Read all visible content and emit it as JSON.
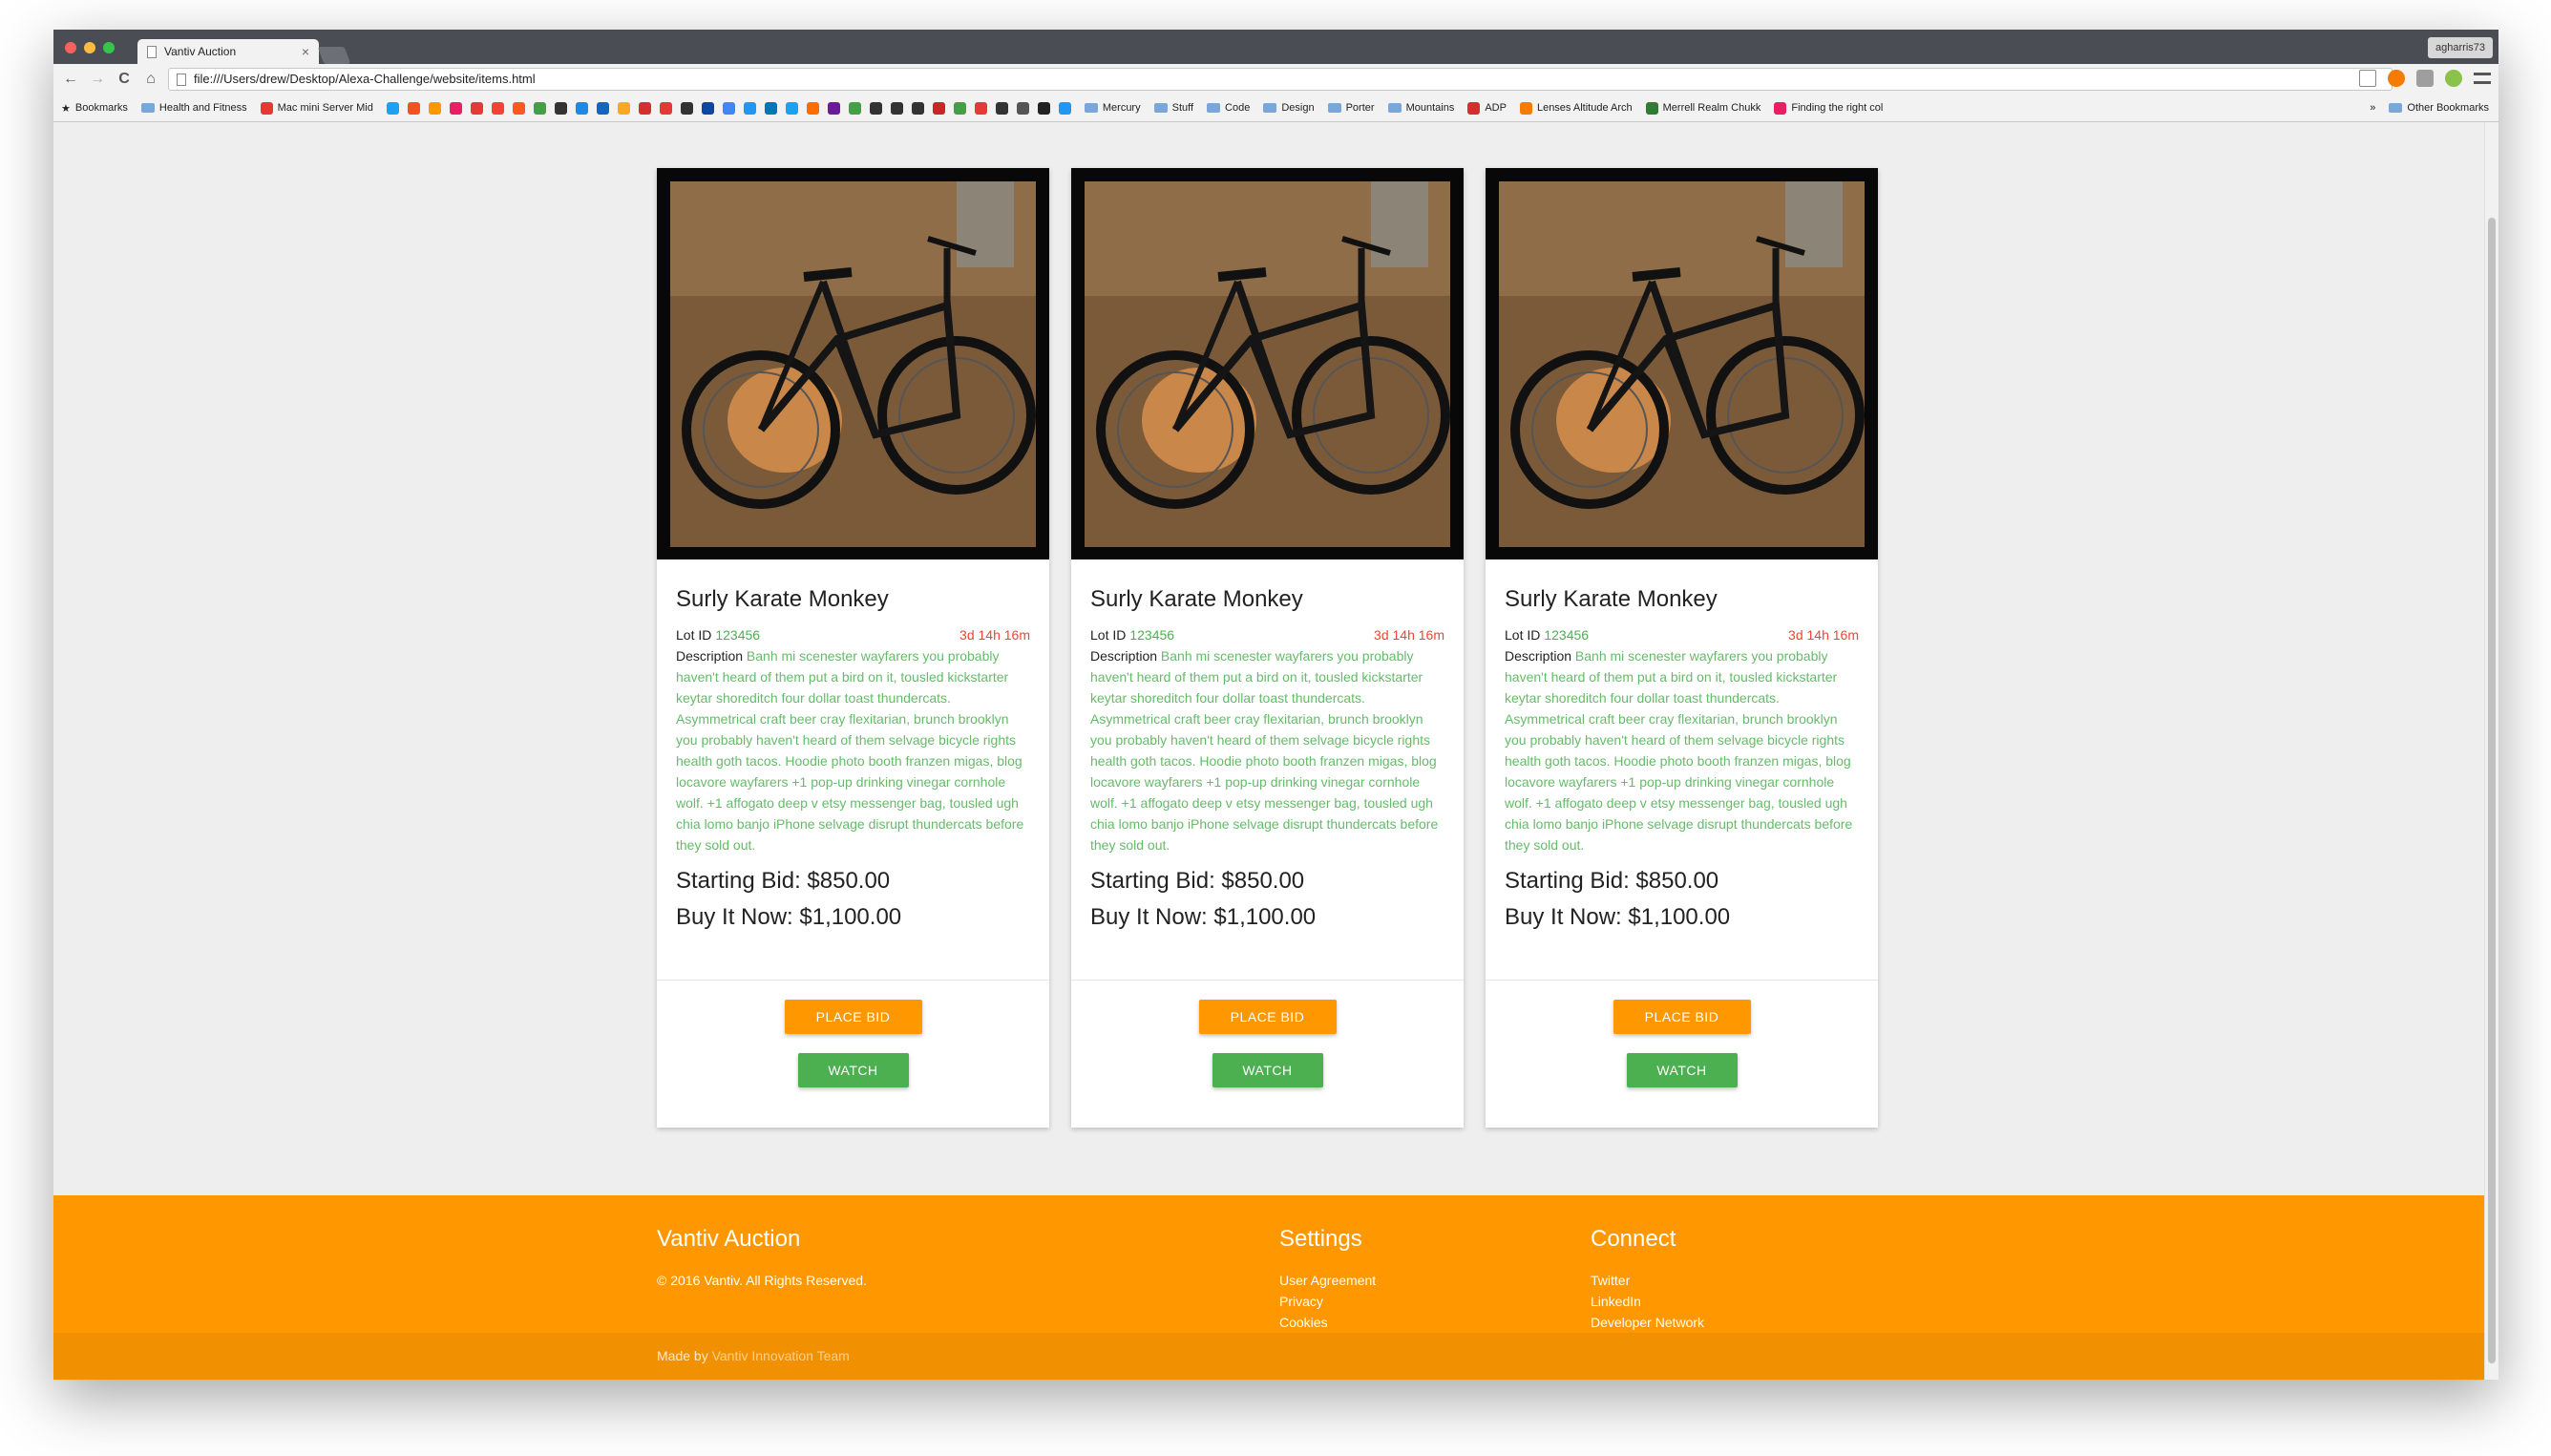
{
  "browser": {
    "tab_title": "Vantiv Auction",
    "tab_close": "×",
    "user": "agharris73",
    "url": "file:///Users/drew/Desktop/Alexa-Challenge/website/items.html",
    "nav": {
      "back": "←",
      "forward": "→",
      "reload": "C",
      "home": "⌂"
    },
    "bookmarks": {
      "bookmarks_label": "Bookmarks",
      "health": "Health and Fitness",
      "macmini": "Mac mini Server Mid",
      "mercury": "Mercury",
      "stuff": "Stuff",
      "code": "Code",
      "design": "Design",
      "porter": "Porter",
      "mountains": "Mountains",
      "adp": "ADP",
      "lenses": "Lenses Altitude Arch",
      "merrell": "Merrell Realm Chukk",
      "finding": "Finding the right col",
      "more": "»",
      "other": "Other Bookmarks"
    },
    "favicon_colors": [
      "#1da1f2",
      "#f4511e",
      "#ff9800",
      "#e91e63",
      "#e53935",
      "#f44336",
      "#ff5722",
      "#43a047",
      "#333333",
      "#1e88e5",
      "#1565c0",
      "#f9a825",
      "#d32f2f",
      "#e53935",
      "#333333",
      "#0d47a1",
      "#4285f4",
      "#2196f3",
      "#0077b5",
      "#1da1f2",
      "#ff6d00",
      "#6a1b9a",
      "#43a047",
      "#333333",
      "#333333",
      "#333333",
      "#c62828",
      "#43a047",
      "#e53935",
      "#333333",
      "#555555",
      "#222222",
      "#2196f3"
    ]
  },
  "items": [
    {
      "title": "Surly Karate Monkey",
      "lot_label": "Lot ID",
      "lot_id": "123456",
      "time_left": "3d 14h 16m",
      "desc_label": "Description",
      "description": "Banh mi scenester wayfarers you probably haven't heard of them put a bird on it, tousled kickstarter keytar shoreditch four dollar toast thundercats. Asymmetrical craft beer cray flexitarian, brunch brooklyn you probably haven't heard of them selvage bicycle rights health goth tacos. Hoodie photo booth franzen migas, blog locavore wayfarers +1 pop-up drinking vinegar cornhole wolf. +1 affogato deep v etsy messenger bag, tousled ugh chia lomo banjo iPhone selvage disrupt thundercats before they sold out.",
      "starting_bid": "Starting Bid: $850.00",
      "buy_now": "Buy It Now: $1,100.00",
      "bid_label": "PLACE BID",
      "watch_label": "WATCH"
    },
    {
      "title": "Surly Karate Monkey",
      "lot_label": "Lot ID",
      "lot_id": "123456",
      "time_left": "3d 14h 16m",
      "desc_label": "Description",
      "description": "Banh mi scenester wayfarers you probably haven't heard of them put a bird on it, tousled kickstarter keytar shoreditch four dollar toast thundercats. Asymmetrical craft beer cray flexitarian, brunch brooklyn you probably haven't heard of them selvage bicycle rights health goth tacos. Hoodie photo booth franzen migas, blog locavore wayfarers +1 pop-up drinking vinegar cornhole wolf. +1 affogato deep v etsy messenger bag, tousled ugh chia lomo banjo iPhone selvage disrupt thundercats before they sold out.",
      "starting_bid": "Starting Bid: $850.00",
      "buy_now": "Buy It Now: $1,100.00",
      "bid_label": "PLACE BID",
      "watch_label": "WATCH"
    },
    {
      "title": "Surly Karate Monkey",
      "lot_label": "Lot ID",
      "lot_id": "123456",
      "time_left": "3d 14h 16m",
      "desc_label": "Description",
      "description": "Banh mi scenester wayfarers you probably haven't heard of them put a bird on it, tousled kickstarter keytar shoreditch four dollar toast thundercats. Asymmetrical craft beer cray flexitarian, brunch brooklyn you probably haven't heard of them selvage bicycle rights health goth tacos. Hoodie photo booth franzen migas, blog locavore wayfarers +1 pop-up drinking vinegar cornhole wolf. +1 affogato deep v etsy messenger bag, tousled ugh chia lomo banjo iPhone selvage disrupt thundercats before they sold out.",
      "starting_bid": "Starting Bid: $850.00",
      "buy_now": "Buy It Now: $1,100.00",
      "bid_label": "PLACE BID",
      "watch_label": "WATCH"
    }
  ],
  "footer": {
    "brand": "Vantiv Auction",
    "copyright": "© 2016 Vantiv. All Rights Reserved.",
    "settings_title": "Settings",
    "settings_links": [
      "User Agreement",
      "Privacy",
      "Cookies"
    ],
    "connect_title": "Connect",
    "connect_links": [
      "Twitter",
      "LinkedIn",
      "Developer Network"
    ],
    "made_by": "Made by",
    "team": "Vantiv Innovation Team"
  },
  "colors": {
    "accent": "#ff9800",
    "accent_dark": "#f19000",
    "watch": "#4caf50",
    "lot_id": "#4caf50",
    "time": "#f44336",
    "description": "#66bb6a"
  }
}
